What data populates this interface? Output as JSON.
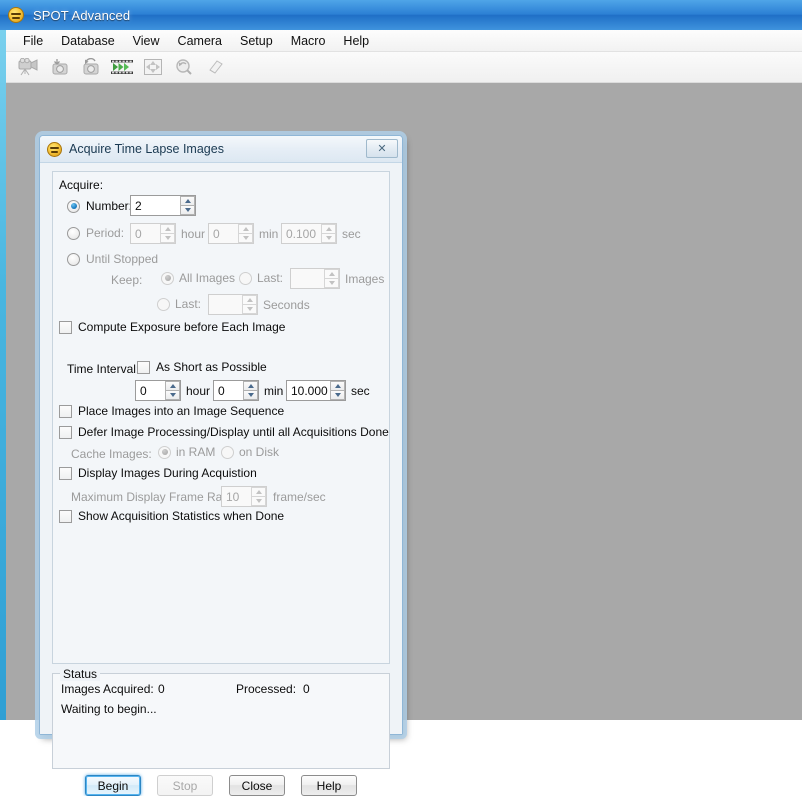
{
  "app": {
    "title": "SPOT Advanced",
    "icon": "spot-logo-icon",
    "menu": [
      "File",
      "Database",
      "View",
      "Camera",
      "Setup",
      "Macro",
      "Help"
    ],
    "toolbar": [
      {
        "name": "video-camera-icon",
        "enabled": false
      },
      {
        "name": "camera-import-icon",
        "enabled": false
      },
      {
        "name": "camera-refresh-icon",
        "enabled": false
      },
      {
        "name": "filmstrip-play-icon",
        "enabled": true
      },
      {
        "name": "fullscreen-arrows-icon",
        "enabled": false
      },
      {
        "name": "magnifier-refresh-icon",
        "enabled": false
      },
      {
        "name": "eraser-icon",
        "enabled": false
      }
    ]
  },
  "dialog": {
    "title": "Acquire Time Lapse Images",
    "close_label": "✕",
    "acquire_legend": "Acquire:",
    "number": {
      "label": "Number:",
      "selected": true,
      "value": "2"
    },
    "period": {
      "label": "Period:",
      "selected": false,
      "hour_value": "0",
      "hour_unit": "hour",
      "min_value": "0",
      "min_unit": "min",
      "sec_value": "0.100",
      "sec_unit": "sec"
    },
    "until_stopped": {
      "label": "Until Stopped",
      "selected": false,
      "keep_label": "Keep:",
      "all_images_label": "All Images",
      "all_images_selected": true,
      "last_images_label": "Last:",
      "last_images_selected": false,
      "last_images_value": "",
      "images_unit": "Images",
      "last_seconds_label": "Last:",
      "last_seconds_selected": false,
      "last_seconds_value": "",
      "seconds_unit": "Seconds"
    },
    "compute_exposure": {
      "label": "Compute Exposure before Each Image",
      "checked": false
    },
    "time_interval": {
      "label": "Time Interval:",
      "as_short_label": "As Short as Possible",
      "as_short_checked": false,
      "hour_value": "0",
      "hour_unit": "hour",
      "min_value": "0",
      "min_unit": "min",
      "sec_value": "10.000",
      "sec_unit": "sec"
    },
    "place_sequence": {
      "label": "Place Images into an Image Sequence",
      "checked": false
    },
    "defer_processing": {
      "label": "Defer Image Processing/Display until all Acquisitions Done",
      "checked": false,
      "cache_label": "Cache Images:",
      "in_ram_label": "in RAM",
      "in_ram_selected": true,
      "on_disk_label": "on Disk",
      "on_disk_selected": false
    },
    "display_during": {
      "label": "Display Images During Acquistion",
      "checked": false,
      "frame_rate_label": "Maximum Display Frame Rate:",
      "frame_rate_value": "10",
      "frame_rate_unit": "frame/sec"
    },
    "show_statistics": {
      "label": "Show Acquisition Statistics when Done",
      "checked": false
    },
    "status": {
      "legend": "Status",
      "acquired_label": "Images Acquired:",
      "acquired_value": "0",
      "processed_label": "Processed:",
      "processed_value": "0",
      "message": "Waiting to begin..."
    },
    "buttons": [
      {
        "label": "Begin",
        "state": "focus"
      },
      {
        "label": "Stop",
        "state": "disabled"
      },
      {
        "label": "Close",
        "state": "normal"
      },
      {
        "label": "Help",
        "state": "normal"
      }
    ]
  },
  "colors": {
    "titlebar_blue": "#2b7fd4",
    "accent_focus": "#2c86c4",
    "desktop_gray": "#a8a8a8",
    "dialog_bg": "#eff3f7"
  }
}
